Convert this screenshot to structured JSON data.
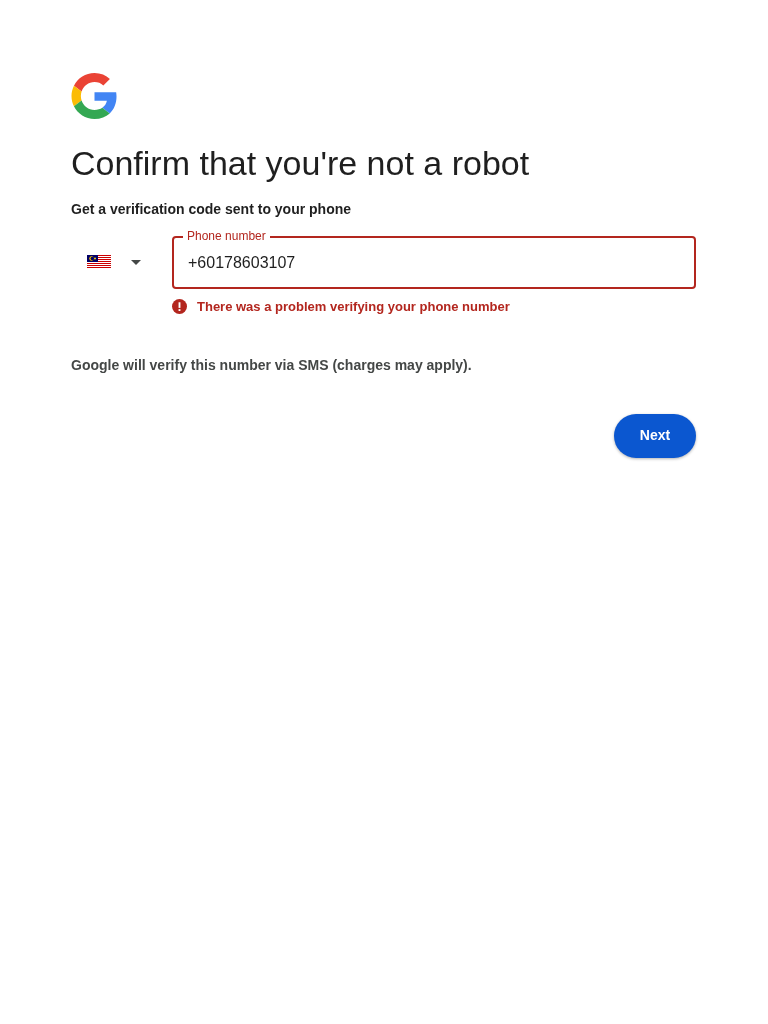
{
  "heading": "Confirm that you're not a robot",
  "subheading": "Get a verification code sent to your phone",
  "phone_field": {
    "label": "Phone number",
    "value": "+60178603107",
    "error": true
  },
  "error_message": "There was a problem verifying your phone number",
  "note": "Google will verify this number via SMS (charges may apply).",
  "next_button": "Next"
}
